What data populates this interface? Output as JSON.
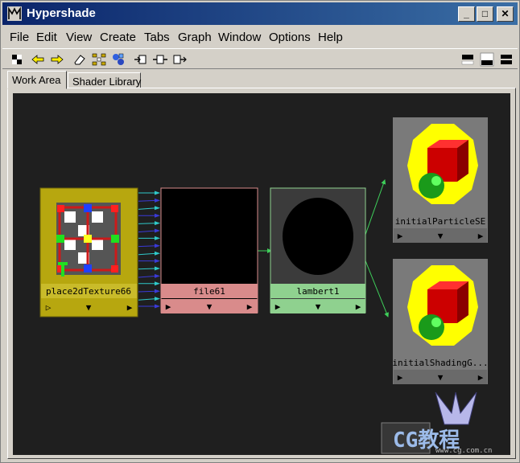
{
  "window": {
    "title": "Hypershade"
  },
  "title_buttons": {
    "minimize": "_",
    "maximize": "□",
    "close": "✕"
  },
  "menu": [
    "File",
    "Edit",
    "View",
    "Create",
    "Tabs",
    "Graph",
    "Window",
    "Options",
    "Help"
  ],
  "tabs": [
    {
      "label": "Work Area",
      "active": true
    },
    {
      "label": "Shader Library",
      "active": false
    }
  ],
  "nodes": {
    "place2d": {
      "label": "place2dTexture66",
      "color": "#b7a70f"
    },
    "file": {
      "label": "file61",
      "color": "#d98b8b"
    },
    "lambert": {
      "label": "lambert1",
      "color": "#8fd18f"
    },
    "sg1": {
      "label": "initialParticleSE"
    },
    "sg2": {
      "label": "initialShadingG..."
    }
  },
  "node_controls": {
    "play": "▷",
    "down": "▼",
    "right": "▶"
  },
  "watermark": {
    "brand": "CG教程",
    "url": "www.cg.com.cn"
  },
  "colors": {
    "canvas": "#1f1f1f",
    "connection": "#3ecf5a",
    "attr_cyan": "#2fc9c9",
    "attr_blue": "#3a3ad8",
    "node_gray": "#7a7a7a"
  }
}
